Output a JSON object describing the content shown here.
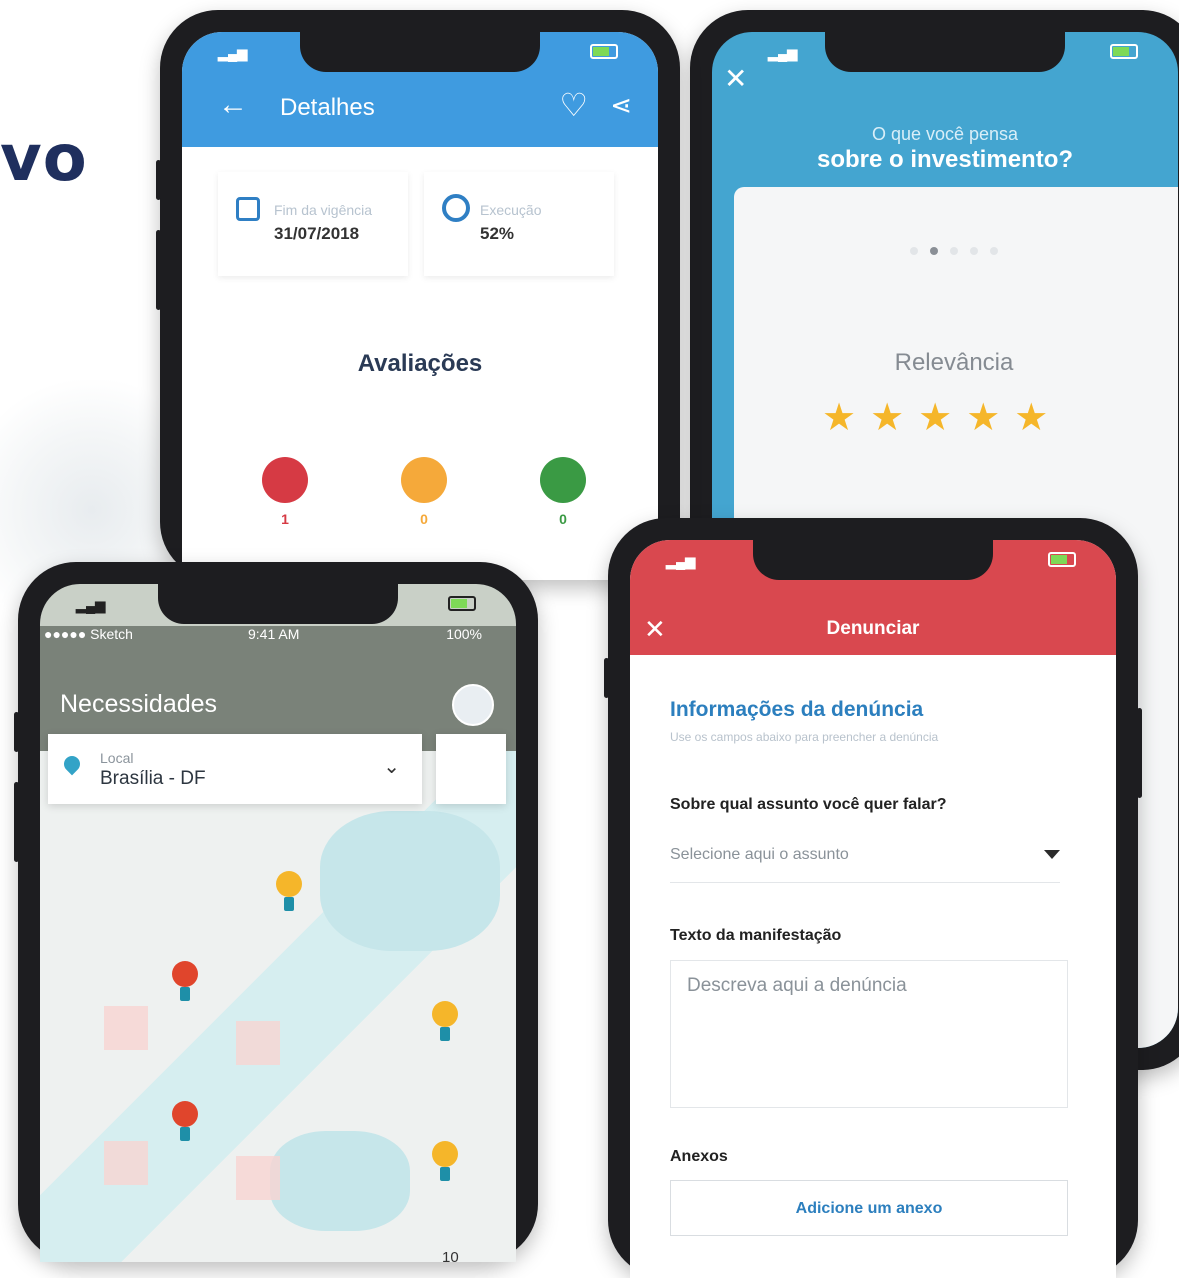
{
  "hero_text": "vo",
  "detalhes": {
    "title": "Detalhes",
    "card_left_label": "Fim da vigência",
    "card_left_value": "31/07/2018",
    "card_right_label": "Execução",
    "card_right_value": "52%",
    "ratings_title": "Avaliações",
    "counts": [
      "1",
      "0",
      "0"
    ]
  },
  "survey": {
    "line1": "O que você pensa",
    "line2": "sobre o investimento?",
    "criterion": "Relevância",
    "stars": "★★★★★"
  },
  "necessidades": {
    "carrier": "●●●●● Sketch",
    "time": "9:41 AM",
    "battery": "100%",
    "title": "Necessidades",
    "local_label": "Local",
    "local_value": "Brasília - DF",
    "cluster_count": "10"
  },
  "denunciar": {
    "title": "Denunciar",
    "section_title": "Informações da denúncia",
    "section_subtitle": "Use os campos abaixo para preencher a denúncia",
    "subject_question": "Sobre qual assunto você quer falar?",
    "subject_placeholder": "Selecione aqui o assunto",
    "text_label": "Texto da manifestação",
    "text_placeholder": "Descreva aqui a denúncia",
    "attachments_label": "Anexos",
    "add_attachment": "Adicione um anexo"
  },
  "colors": {
    "blue_header": "#3f9be0",
    "survey_bg": "#44a5d0",
    "red_header": "#d9484f",
    "accent_text": "#2c7fbe",
    "star": "#f5b62a"
  }
}
